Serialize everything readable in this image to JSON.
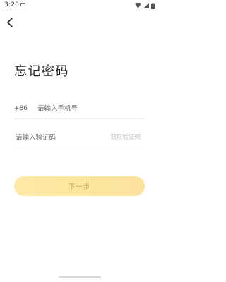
{
  "status_bar": {
    "time": "3:20",
    "icons": [
      "notification-icon",
      "wifi-icon",
      "signal-icon",
      "battery-icon"
    ]
  },
  "header": {
    "back_icon": "chevron-left-icon"
  },
  "page": {
    "title": "忘记密码"
  },
  "form": {
    "country_code": "+86",
    "phone_placeholder": "请输入手机号",
    "phone_value": "",
    "code_placeholder": "请输入验证码",
    "code_value": "",
    "get_code_label": "获取验证码",
    "next_label": "下一步"
  },
  "colors": {
    "accent": "#fde69c",
    "accent_text": "#b9a56c",
    "muted_text": "#c4c4c4"
  }
}
